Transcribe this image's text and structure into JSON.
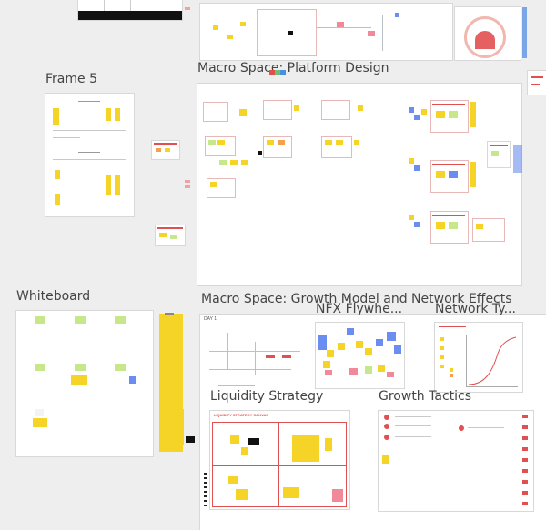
{
  "frames": {
    "frame5": {
      "title": "Frame 5"
    },
    "platform": {
      "title": "Macro Space: Platform Design"
    },
    "whiteboard": {
      "title": "Whiteboard"
    },
    "growth": {
      "title": "Macro Space: Growth Model and Network Effects"
    },
    "nfx": {
      "title": "NFX Flywhe..."
    },
    "network": {
      "title": "Network Ty..."
    },
    "liquidity": {
      "title": "Liquidity Strategy"
    },
    "tactics": {
      "title": "Growth Tactics"
    }
  },
  "inner_labels": {
    "day1": "DAY 1",
    "liquidity_header": "LIQUIDITY STRATEGY CANVAS"
  },
  "colors": {
    "canvas_bg": "#eeeeee",
    "frame_bg": "#ffffff",
    "sticky_yellow": "#f5d327",
    "sticky_green": "#c6e88a",
    "sticky_pink": "#f08a9a",
    "sticky_blue": "#6b8cf0",
    "accent_red": "#e05050"
  }
}
